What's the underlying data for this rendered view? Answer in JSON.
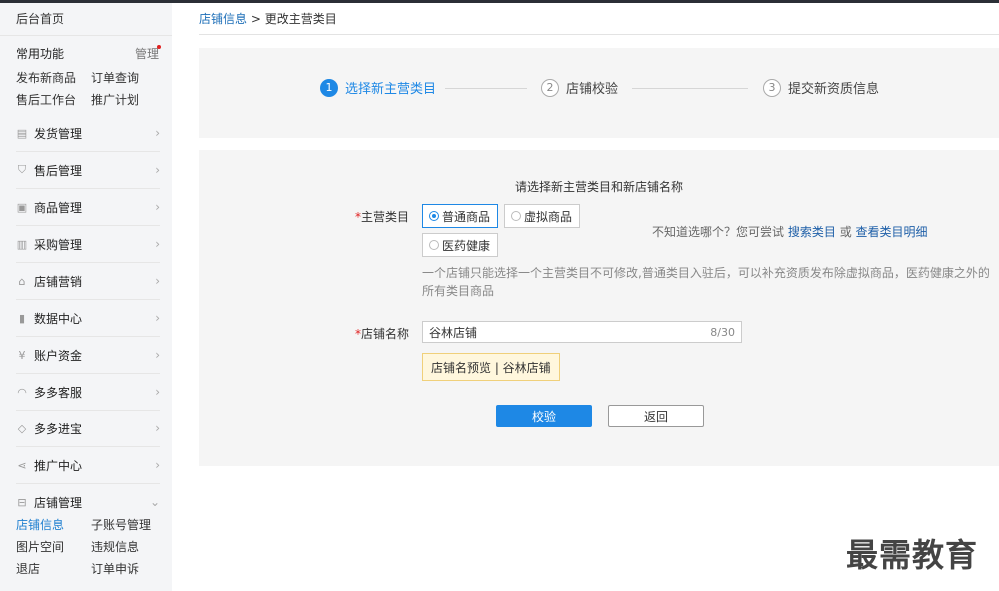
{
  "sidebar": {
    "home": "后台首页",
    "common_title": "常用功能",
    "manage": "管理",
    "quick_links": [
      "发布新商品",
      "订单查询",
      "售后工作台",
      "推广计划"
    ],
    "menu": [
      {
        "icon": "document-icon",
        "label": "发货管理"
      },
      {
        "icon": "shield-icon",
        "label": "售后管理"
      },
      {
        "icon": "box-icon",
        "label": "商品管理"
      },
      {
        "icon": "purchase-icon",
        "label": "采购管理"
      },
      {
        "icon": "store-icon",
        "label": "店铺营销"
      },
      {
        "icon": "bar-chart-icon",
        "label": "数据中心"
      },
      {
        "icon": "yen-icon",
        "label": "账户资金"
      },
      {
        "icon": "headset-icon",
        "label": "多多客服"
      },
      {
        "icon": "gem-icon",
        "label": "多多进宝"
      },
      {
        "icon": "share-icon",
        "label": "推广中心"
      },
      {
        "icon": "shop-icon",
        "label": "店铺管理"
      }
    ],
    "submenu": [
      "店铺信息",
      "子账号管理",
      "图片空间",
      "违规信息",
      "退店",
      "订单申诉"
    ]
  },
  "breadcrumb": {
    "link": "店铺信息",
    "sep": ">",
    "current": "更改主营类目"
  },
  "steps": [
    {
      "num": "1",
      "label": "选择新主营类目"
    },
    {
      "num": "2",
      "label": "店铺校验"
    },
    {
      "num": "3",
      "label": "提交新资质信息"
    }
  ],
  "form": {
    "title": "请选择新主营类目和新店铺名称",
    "category_label": "主营类目",
    "options": [
      "普通商品",
      "虚拟商品",
      "医药健康"
    ],
    "hint_prefix": "不知道选哪个？您可尝试",
    "hint_link1": "搜索类目",
    "hint_or": "或",
    "hint_link2": "查看类目明细",
    "description": "一个店铺只能选择一个主营类目不可修改,普通类目入驻后，可以补充资质发布除虚拟商品，医药健康之外的所有类目商品",
    "name_label": "店铺名称",
    "name_value": "谷林店铺",
    "name_count": "8/30",
    "preview": "店铺名预览 | 谷林店铺",
    "submit": "校验",
    "back": "返回"
  },
  "watermark": "最需教育",
  "colors": {
    "accent": "#1e88e5",
    "link": "#1e6fb8",
    "required": "#e02020"
  }
}
